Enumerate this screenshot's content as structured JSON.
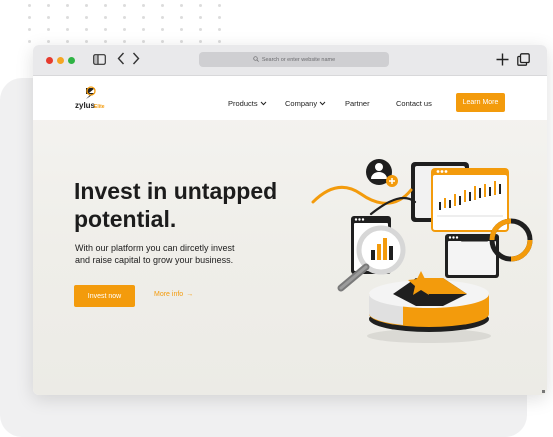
{
  "browser": {
    "url_placeholder": "Search or enter website name",
    "traffic_light_colors": [
      "#e63b2e",
      "#f5a623",
      "#2fb344"
    ],
    "icons": [
      "sidebar-icon",
      "back-icon",
      "forward-icon",
      "search-icon",
      "new-tab-icon",
      "tabs-icon"
    ]
  },
  "nav": {
    "logo_text": "zylus",
    "logo_accent_text": "Elite",
    "items": [
      {
        "label": "Products",
        "dropdown": true
      },
      {
        "label": "Company",
        "dropdown": true
      },
      {
        "label": "Partner",
        "dropdown": false
      },
      {
        "label": "Contact us",
        "dropdown": false
      }
    ],
    "cta_label": "Learn More"
  },
  "hero": {
    "title_line1": "Invest in untapped",
    "title_line2": "potential.",
    "subtitle_line1": "With our platform you can dircetly invest",
    "subtitle_line2": "and raise capital to grow your business.",
    "primary_button": "Invest now",
    "secondary_link": "More info",
    "secondary_arrow": "→"
  },
  "theme": {
    "accent": "#f39b0c",
    "text": "#1c1c1c"
  }
}
